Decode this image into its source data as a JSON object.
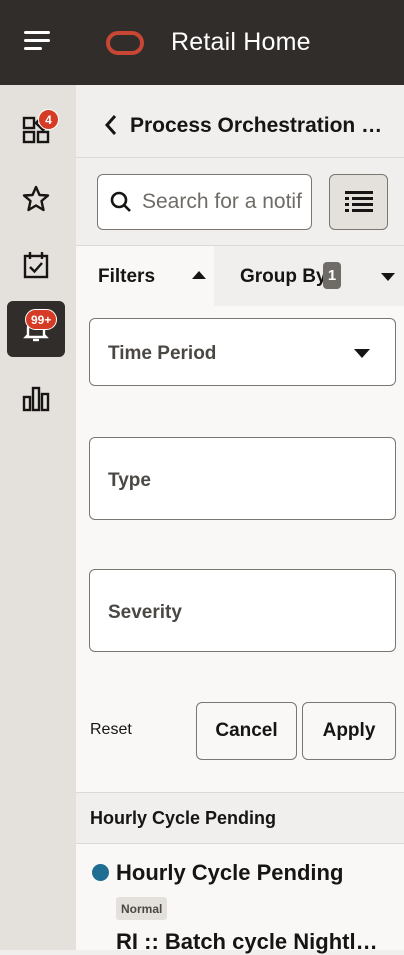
{
  "app": {
    "title": "Retail Home"
  },
  "nav": {
    "dashboard_badge": "4",
    "notifications_badge": "99+"
  },
  "header": {
    "title": "Process Orchestration Monitor"
  },
  "search": {
    "placeholder": "Search for a notification"
  },
  "tabs": {
    "filters_label": "Filters",
    "group_by_label": "Group By",
    "group_by_count": "1"
  },
  "filters": {
    "time_period_label": "Time Period",
    "type_label": "Type",
    "severity_label": "Severity",
    "reset_label": "Reset",
    "cancel_label": "Cancel",
    "apply_label": "Apply"
  },
  "group": {
    "title": "Hourly Cycle Pending",
    "notification": {
      "title": "Hourly Cycle Pending",
      "severity": "Normal",
      "description": "RI :: Batch cycle Nightly for RI is pending"
    }
  },
  "colors": {
    "topbar": "#312d2a",
    "brand": "#c74634",
    "badge": "#d63b25",
    "notification_dot": "#1f6d92"
  }
}
